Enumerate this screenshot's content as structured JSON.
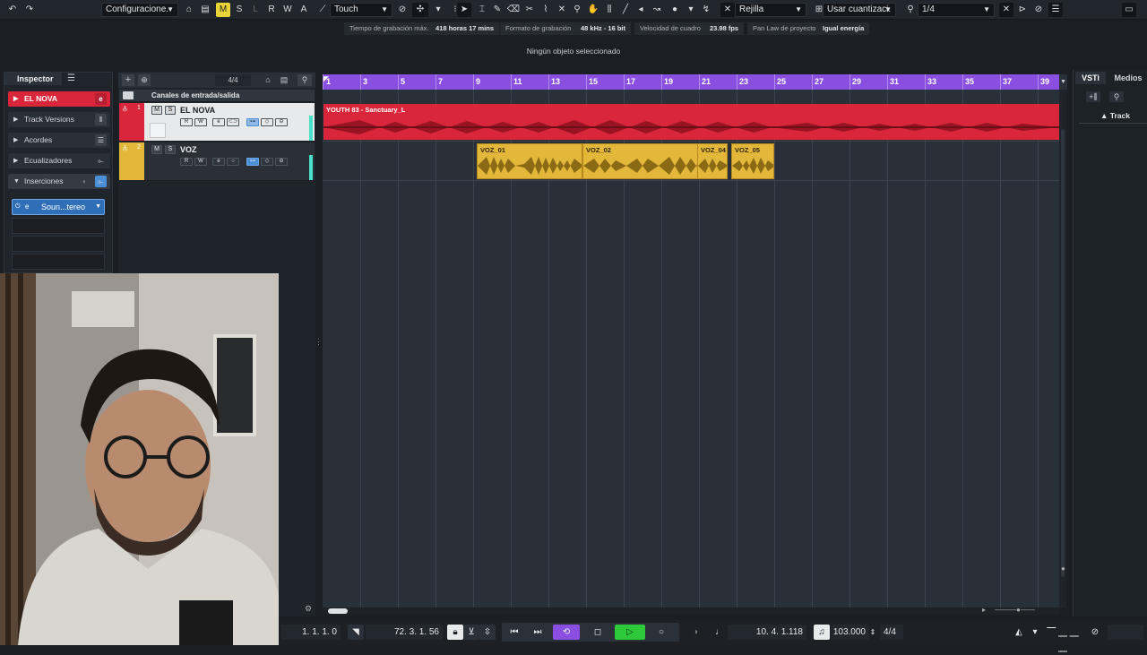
{
  "toolbar": {
    "config_label": "Configuracione.",
    "mode_buttons": [
      "M",
      "S",
      "L",
      "R",
      "W",
      "A"
    ],
    "automation_mode": "Touch",
    "grid_type": "Rejilla",
    "quantize_mode": "Usar cuantizaci.",
    "quantize_value": "1/4"
  },
  "infobar": {
    "items": [
      {
        "label": "Tiempo de grabación máx.",
        "value": "418 horas 17 mins"
      },
      {
        "label": "Formato de grabación",
        "value": "48 kHz - 16 bit"
      },
      {
        "label": "Velocidad de cuadro",
        "value": "23.98 fps"
      },
      {
        "label": "Pan Law de proyecto",
        "value": "Igual energía"
      }
    ],
    "status": "Ningún objeto seleccionado"
  },
  "inspector": {
    "tab": "Inspector",
    "track_name": "EL NOVA",
    "sections": [
      "Track Versions",
      "Acordes",
      "Ecualizadores",
      "Inserciones"
    ],
    "insert_slot": "Soun...tereo"
  },
  "tracklist": {
    "signature": "4/4",
    "folder_label": "Canales de entrada/salida",
    "tracks": [
      {
        "number": "1",
        "name": "EL NOVA",
        "color": "#d9263b"
      },
      {
        "number": "2",
        "name": "VOZ",
        "color": "#e3b83a"
      }
    ]
  },
  "ruler": {
    "bars": [
      "1",
      "3",
      "5",
      "7",
      "9",
      "11",
      "13",
      "15",
      "17",
      "19",
      "21",
      "23",
      "25",
      "27",
      "29",
      "31",
      "33",
      "35",
      "37",
      "39"
    ]
  },
  "parts": {
    "audio_main": "YOUTH 83 - Sanctuary_L",
    "voz_parts": [
      "VOZ_01",
      "VOZ_02",
      "VOZ_04",
      "VOZ_05"
    ]
  },
  "rightzone": {
    "tabs": [
      "VSTi",
      "Medios"
    ],
    "track_label": "Track"
  },
  "transport": {
    "left_locator": "1. 1. 1. 0",
    "right_locator": "72. 3. 1. 56",
    "position": "10. 4. 1.118",
    "tempo": "103.000",
    "signature": "4/4"
  },
  "colors": {
    "ruler": "#8a4fe0",
    "audio_red": "#d9263b",
    "voz_yellow": "#e3b83a",
    "play_green": "#2ec93b",
    "cycle_purple": "#8a4fe0"
  }
}
